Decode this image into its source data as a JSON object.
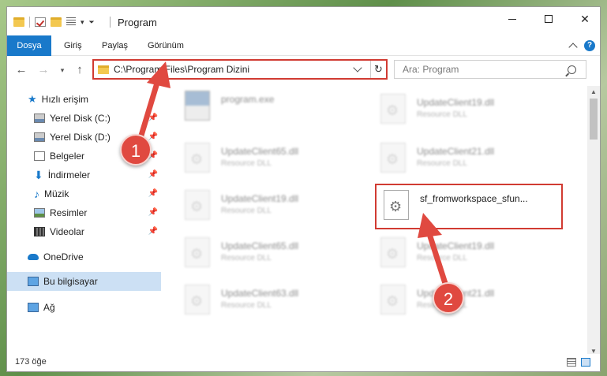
{
  "window": {
    "title": "Program"
  },
  "ribbon": {
    "tabs": [
      "Dosya",
      "Giriş",
      "Paylaş",
      "Görünüm"
    ],
    "help": "?"
  },
  "nav": {
    "address": "C:\\Program Files\\Program Dizini",
    "search_placeholder": "Ara: Program"
  },
  "sidebar": {
    "items": [
      {
        "label": "Hızlı erişim"
      },
      {
        "label": "Yerel Disk (C:)"
      },
      {
        "label": "Yerel Disk (D:)"
      },
      {
        "label": "Belgeler"
      },
      {
        "label": "İndirmeler"
      },
      {
        "label": "Müzik"
      },
      {
        "label": "Resimler"
      },
      {
        "label": "Videolar"
      },
      {
        "label": "OneDrive"
      },
      {
        "label": "Bu bilgisayar"
      },
      {
        "label": "Ağ"
      }
    ]
  },
  "files": [
    {
      "name": "program.exe",
      "type": ""
    },
    {
      "name": "UpdateClient19.dll",
      "type": "Resource DLL"
    },
    {
      "name": "UpdateClient65.dll",
      "type": "Resource DLL"
    },
    {
      "name": "UpdateClient21.dll",
      "type": "Resource DLL"
    },
    {
      "name": "UpdateClient19.dll",
      "type": "Resource DLL"
    },
    {
      "name": "sf_fromworkspace_sfun...",
      "type": ""
    },
    {
      "name": "UpdateClient65.dll",
      "type": "Resource DLL"
    },
    {
      "name": "UpdateClient19.dll",
      "type": "Resource DLL"
    },
    {
      "name": "UpdateClient63.dll",
      "type": "Resource DLL"
    },
    {
      "name": "UpdateClient21.dll",
      "type": "Resource DLL"
    }
  ],
  "status": {
    "count": "173 öğe"
  },
  "callouts": [
    "1",
    "2"
  ],
  "colors": {
    "accent": "#1979ca",
    "highlight": "#d13b32",
    "badge": "#e04940"
  }
}
